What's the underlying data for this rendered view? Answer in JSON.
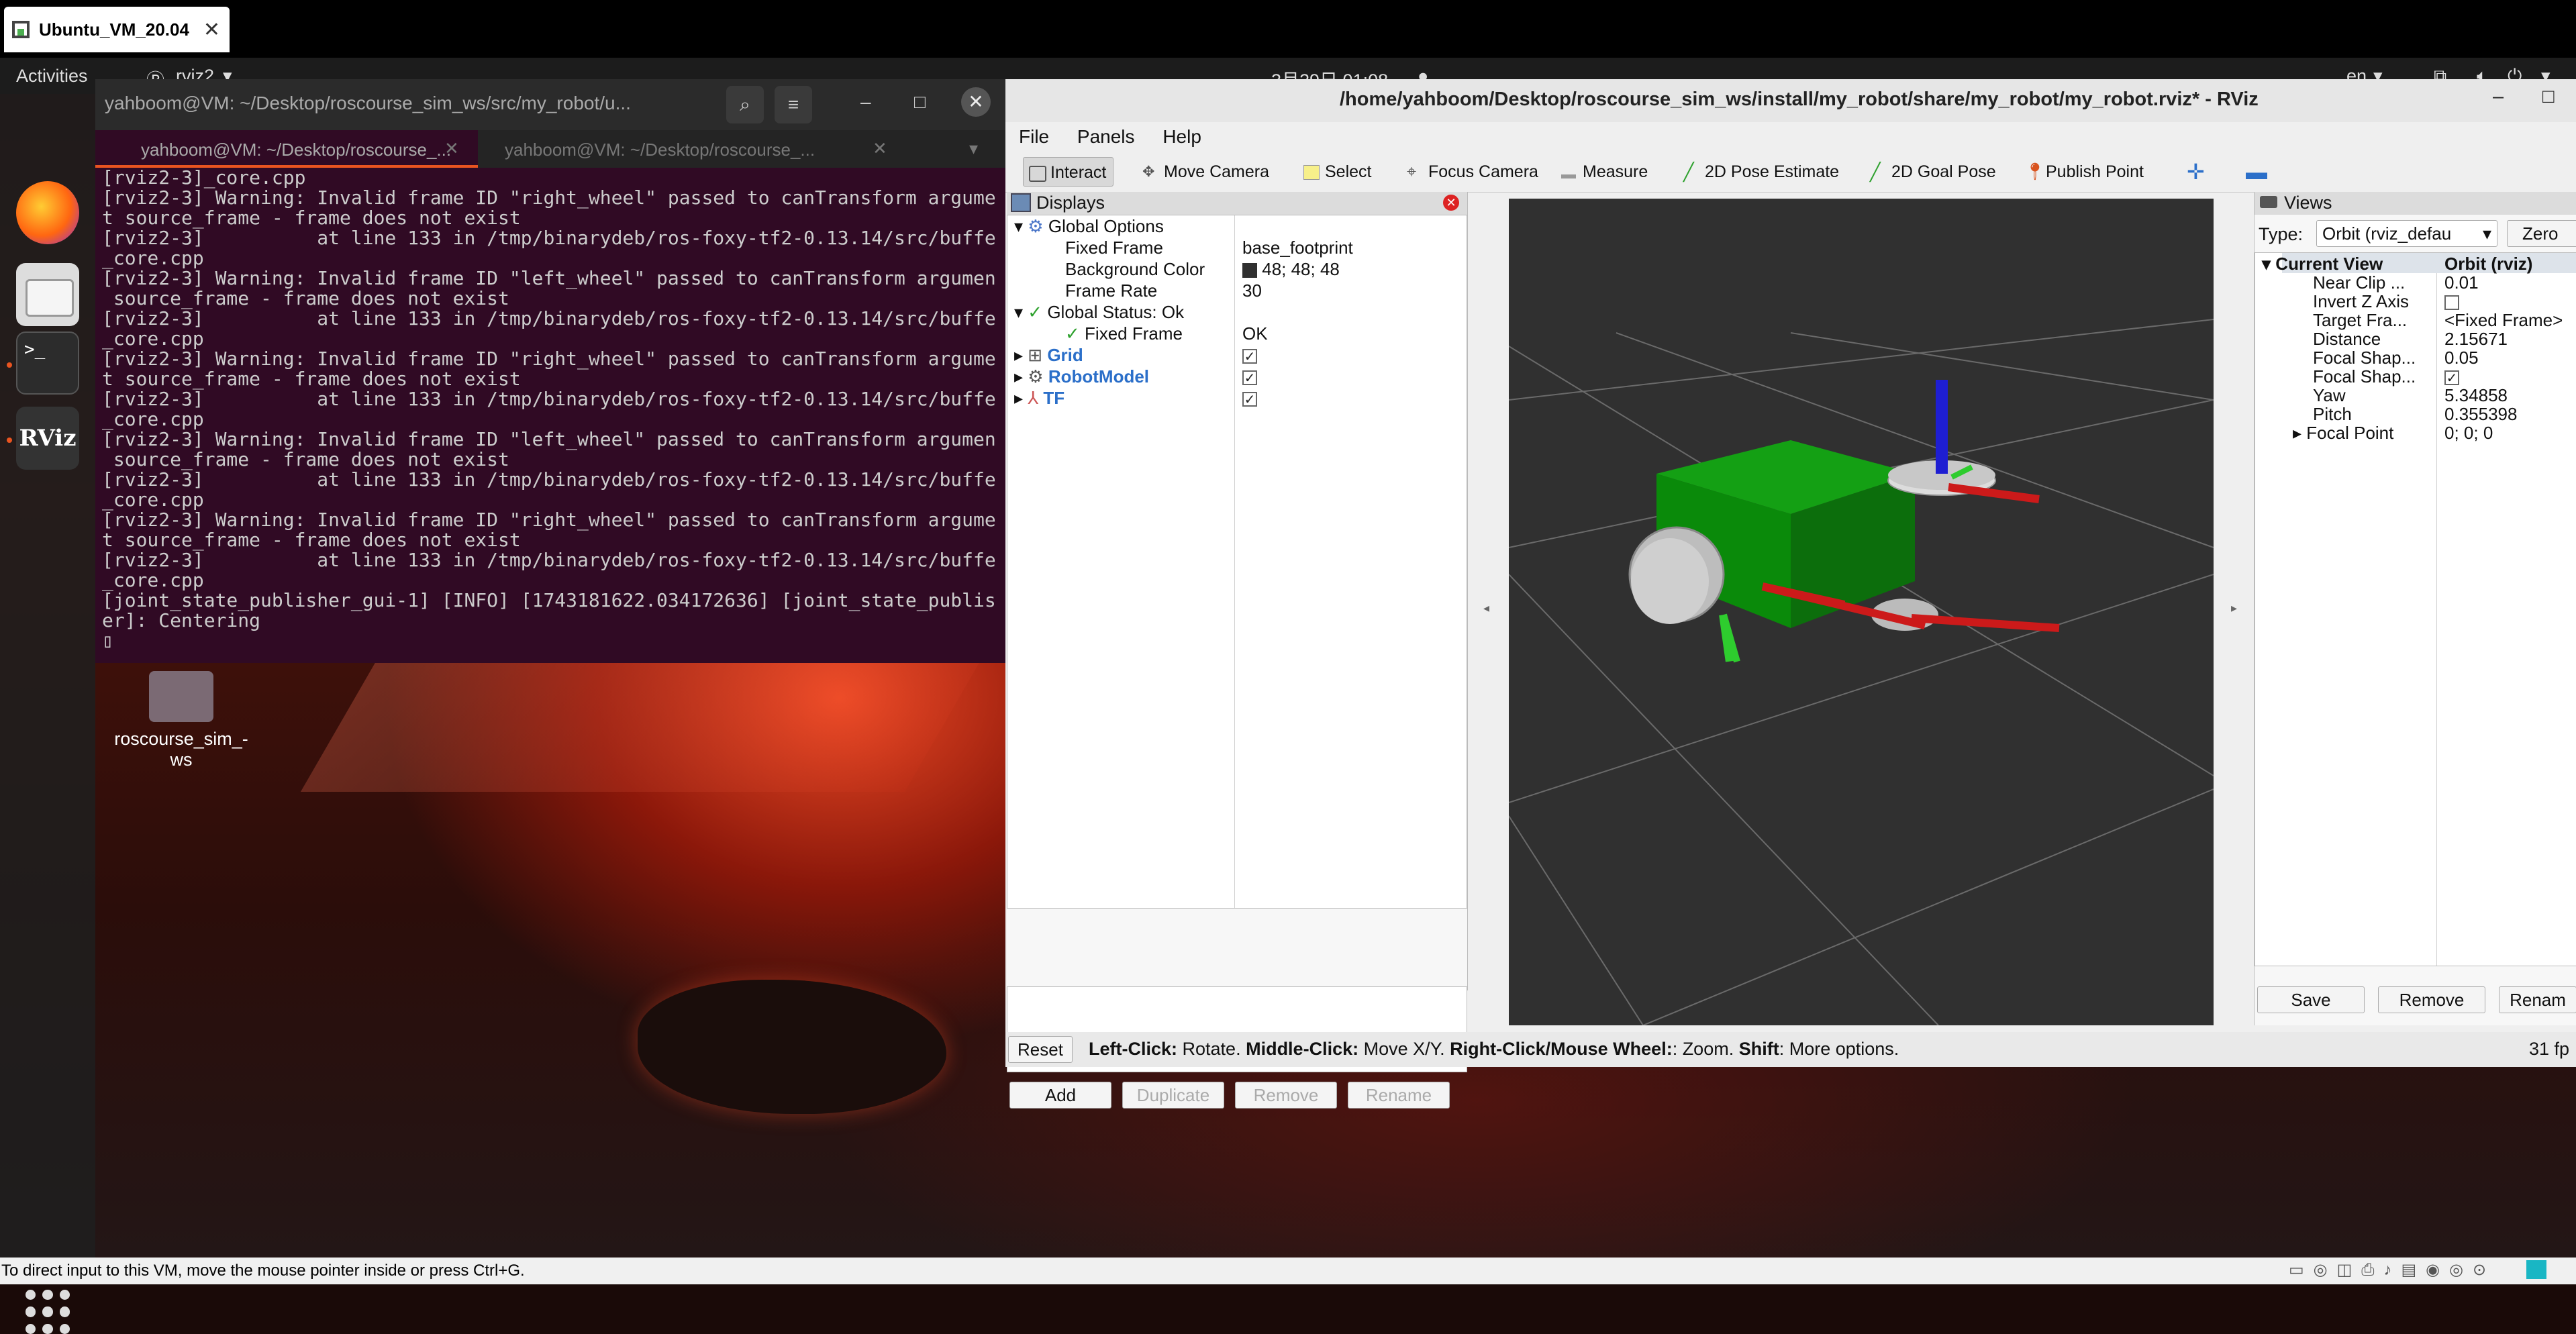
{
  "vm": {
    "tab_title": "Ubuntu_VM_20.04",
    "bottom_hint": "To direct input to this VM, move the mouse pointer inside or press Ctrl+G."
  },
  "topbar": {
    "activities": "Activities",
    "app_name": "rviz2",
    "clock": "3月29日  01:08",
    "lang": "en"
  },
  "dock": {
    "tooltip": "rviz2",
    "rviz_label": "RViz",
    "terminal_glyph": ">_"
  },
  "desktop": {
    "folder_label": "roscourse_sim_-\nws"
  },
  "terminal": {
    "title": "yahboom@VM: ~/Desktop/roscourse_sim_ws/src/my_robot/u...",
    "tabs": [
      "yahboom@VM: ~/Desktop/roscourse_...",
      "yahboom@VM: ~/Desktop/roscourse_..."
    ],
    "lines": [
      "[rviz2-3]_core.cpp",
      "[rviz2-3] Warning: Invalid frame ID \"right_wheel\" passed to canTransform argumen",
      "t source_frame - frame does not exist",
      "[rviz2-3]          at line 133 in /tmp/binarydeb/ros-foxy-tf2-0.13.14/src/buffer",
      "_core.cpp",
      "[rviz2-3] Warning: Invalid frame ID \"left_wheel\" passed to canTransform argument",
      " source_frame - frame does not exist",
      "[rviz2-3]          at line 133 in /tmp/binarydeb/ros-foxy-tf2-0.13.14/src/buffer",
      "_core.cpp",
      "[rviz2-3] Warning: Invalid frame ID \"right_wheel\" passed to canTransform argumen",
      "t source_frame - frame does not exist",
      "[rviz2-3]          at line 133 in /tmp/binarydeb/ros-foxy-tf2-0.13.14/src/buffer",
      "_core.cpp",
      "[rviz2-3] Warning: Invalid frame ID \"left_wheel\" passed to canTransform argument",
      " source_frame - frame does not exist",
      "[rviz2-3]          at line 133 in /tmp/binarydeb/ros-foxy-tf2-0.13.14/src/buffer",
      "_core.cpp",
      "[rviz2-3] Warning: Invalid frame ID \"right_wheel\" passed to canTransform argumen",
      "t source_frame - frame does not exist",
      "[rviz2-3]          at line 133 in /tmp/binarydeb/ros-foxy-tf2-0.13.14/src/buffer",
      "_core.cpp",
      "[joint_state_publisher_gui-1] [INFO] [1743181622.034172636] [joint_state_publish",
      "er]: Centering",
      "▯"
    ]
  },
  "rviz": {
    "title": "/home/yahboom/Desktop/roscourse_sim_ws/install/my_robot/share/my_robot/my_robot.rviz* - RViz",
    "menu": [
      "File",
      "Panels",
      "Help"
    ],
    "tools": [
      "Interact",
      "Move Camera",
      "Select",
      "Focus Camera",
      "Measure",
      "2D Pose Estimate",
      "2D Goal Pose",
      "Publish Point"
    ],
    "displays": {
      "header": "Displays",
      "global_options": "Global Options",
      "fixed_frame_label": "Fixed Frame",
      "fixed_frame_value": "base_footprint",
      "bg_color_label": "Background Color",
      "bg_color_value": "48; 48; 48",
      "frame_rate_label": "Frame Rate",
      "frame_rate_value": "30",
      "global_status": "Global Status: Ok",
      "status_fixed_frame": "Fixed Frame",
      "status_fixed_frame_value": "OK",
      "grid": "Grid",
      "robot_model": "RobotModel",
      "tf": "TF",
      "buttons": [
        "Add",
        "Duplicate",
        "Remove",
        "Rename"
      ]
    },
    "views": {
      "header": "Views",
      "type_label": "Type:",
      "type_value": "Orbit (rviz_defau",
      "zero_button": "Zero",
      "current_view": "Current View",
      "current_view_type": "Orbit (rviz)",
      "props": [
        {
          "k": "Near Clip ...",
          "v": "0.01"
        },
        {
          "k": "Invert Z Axis",
          "v": ""
        },
        {
          "k": "Target Fra...",
          "v": "<Fixed Frame>"
        },
        {
          "k": "Distance",
          "v": "2.15671"
        },
        {
          "k": "Focal Shap...",
          "v": "0.05"
        },
        {
          "k": "Focal Shap...",
          "v": ""
        },
        {
          "k": "Yaw",
          "v": "5.34858"
        },
        {
          "k": "Pitch",
          "v": "0.355398"
        },
        {
          "k": "Focal Point",
          "v": "0; 0; 0"
        }
      ],
      "buttons": [
        "Save",
        "Remove",
        "Renam"
      ]
    },
    "status": {
      "reset": "Reset",
      "b1": "Left-Click:",
      "t1": " Rotate. ",
      "b2": "Middle-Click:",
      "t2": " Move X/Y. ",
      "b3": "Right-Click/Mouse Wheel:",
      "t3": ": Zoom. ",
      "b4": "Shift",
      "t4": ": More options.",
      "fps": "31 fp"
    }
  },
  "colors": {
    "accent": "#e95420",
    "terminal_bg": "#300a24",
    "view_bg": "#303030",
    "robot_body": "#0a8a0a"
  }
}
